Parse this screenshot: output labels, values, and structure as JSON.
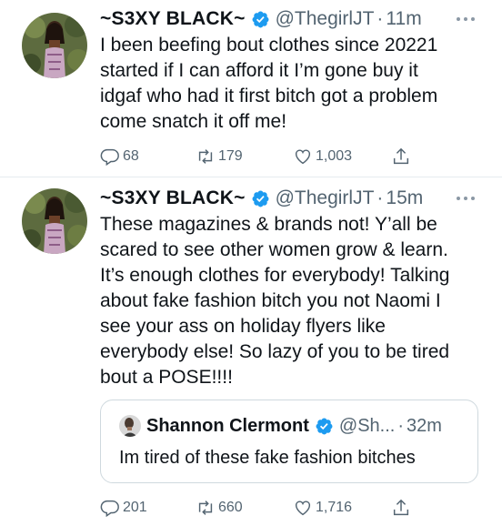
{
  "tweets": [
    {
      "author": {
        "name": "~S3XY BLACK~",
        "handle": "@ThegirlJT",
        "separator": "·",
        "time": "11m"
      },
      "text": "I been beefing bout clothes since 20221\nstarted if I can afford it I’m gone buy it\nidgaf who had it first bitch got a problem\ncome snatch it off me!",
      "stats": {
        "replies": "68",
        "retweets": "179",
        "likes": "1,003"
      }
    },
    {
      "author": {
        "name": "~S3XY BLACK~",
        "handle": "@ThegirlJT",
        "separator": "·",
        "time": "15m"
      },
      "text": "These magazines & brands not! Y’all be\nscared to see other women grow & learn.\nIt’s enough clothes for everybody! Talking\nabout fake fashion bitch you not Naomi I\nsee your ass on holiday flyers like\neverybody else! So lazy of you to be tired\nbout a POSE!!!!",
      "quote": {
        "name": "Shannon Clermont",
        "handle": "@Sh...",
        "separator": "·",
        "time": "32m",
        "text": "Im tired of these fake fashion bitches"
      },
      "stats": {
        "replies": "201",
        "retweets": "660",
        "likes": "1,716"
      }
    }
  ],
  "colors": {
    "verified": "#1d9bf0",
    "muted": "#536471",
    "divider": "#e6ecf0"
  },
  "icons": [
    "verified-badge-icon",
    "more-icon",
    "reply-icon",
    "retweet-icon",
    "like-icon",
    "share-icon"
  ]
}
